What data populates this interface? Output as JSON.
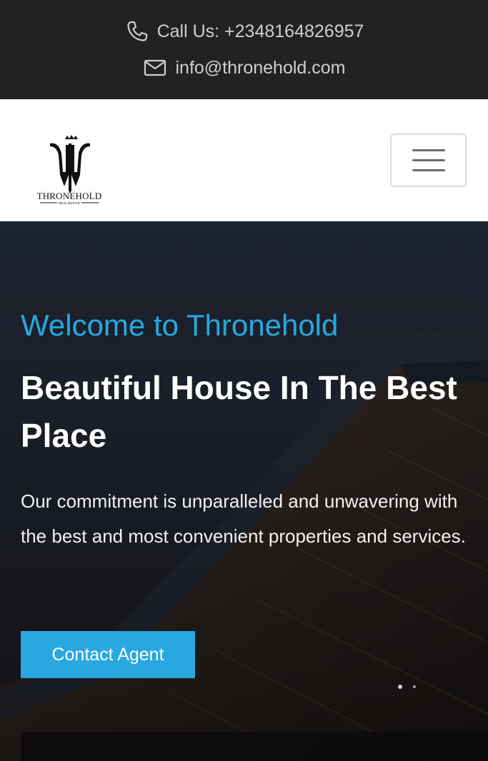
{
  "topbar": {
    "phone_text": "Call Us: +2348164826957",
    "email_text": "info@thronehold.com",
    "phone_icon": "phone-icon",
    "email_icon": "envelope-icon"
  },
  "navbar": {
    "logo_text": "THRONEHOLD",
    "logo_subtext": "REAL ESTATE",
    "menu_icon": "hamburger-icon"
  },
  "hero": {
    "welcome": "Welcome to Thronehold",
    "headline": "Beautiful House In The Best Place",
    "lead": "Our commitment is unparalleled and unwavering with the best and most convenient properties and services.",
    "cta_label": "Contact Agent"
  },
  "colors": {
    "accent": "#29a8e0",
    "topbar_bg": "#222222",
    "hero_text": "#ffffff"
  }
}
